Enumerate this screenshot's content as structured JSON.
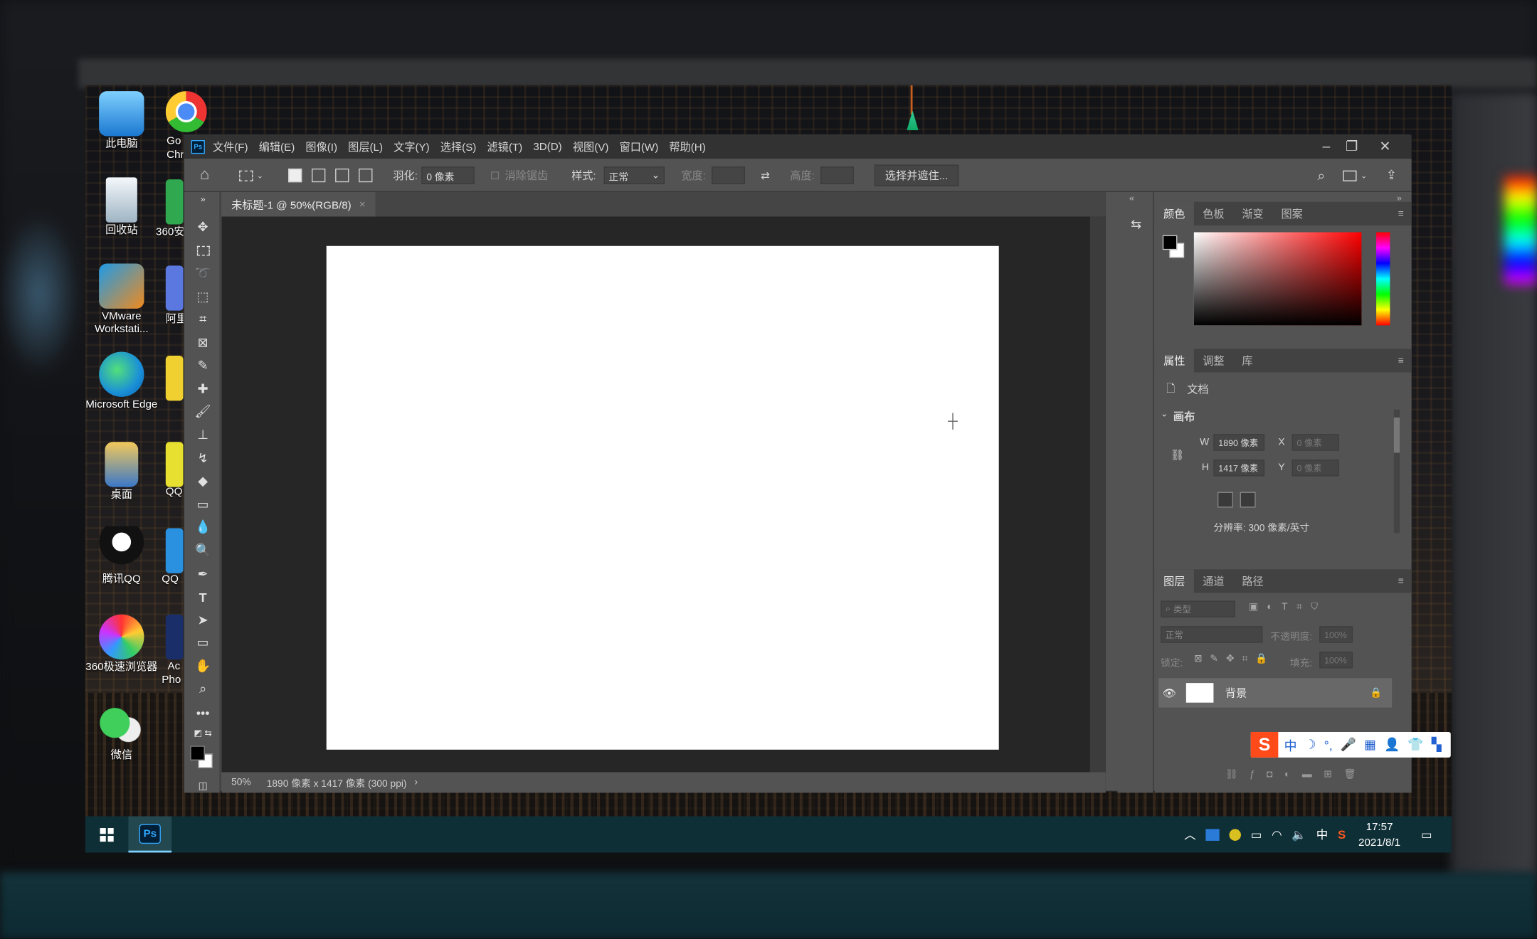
{
  "desktop": {
    "icons": [
      {
        "label": "此电脑"
      },
      {
        "label": "回收站"
      },
      {
        "label": "VMware Workstati..."
      },
      {
        "label": "Microsoft Edge"
      },
      {
        "label": "桌面"
      },
      {
        "label": "腾讯QQ"
      },
      {
        "label": "360极速浏览器"
      },
      {
        "label": "微信"
      }
    ],
    "partial_labels": [
      "Go",
      "Chr",
      "360安",
      "阿里",
      "QQ",
      "QQ",
      "Ac",
      "Pho"
    ]
  },
  "ps": {
    "menu": [
      "文件(F)",
      "编辑(E)",
      "图像(I)",
      "图层(L)",
      "文字(Y)",
      "选择(S)",
      "滤镜(T)",
      "3D(D)",
      "视图(V)",
      "窗口(W)",
      "帮助(H)"
    ],
    "options": {
      "feather_label": "羽化:",
      "feather_value": "0 像素",
      "antialias": "消除锯齿",
      "style_label": "样式:",
      "style_value": "正常",
      "width_label": "宽度:",
      "height_label": "高度:",
      "select_mask": "选择并遮住..."
    },
    "doc_tab": "未标题-1 @ 50%(RGB/8)",
    "status": {
      "zoom": "50%",
      "info": "1890 像素 x 1417 像素 (300 ppi)"
    },
    "color_panel": {
      "tabs": [
        "颜色",
        "色板",
        "渐变",
        "图案"
      ]
    },
    "properties_panel": {
      "tabs": [
        "属性",
        "调整",
        "库"
      ],
      "doc_label": "文档",
      "section": "画布",
      "w_label": "W",
      "w_value": "1890 像素",
      "h_label": "H",
      "h_value": "1417 像素",
      "x_label": "X",
      "x_value": "0 像素",
      "y_label": "Y",
      "y_value": "0 像素",
      "resolution": "分辨率: 300 像素/英寸"
    },
    "layers_panel": {
      "tabs": [
        "图层",
        "通道",
        "路径"
      ],
      "filter": "类型",
      "blend": "正常",
      "opacity_label": "不透明度:",
      "opacity_value": "100%",
      "lock_label": "锁定:",
      "fill_label": "填充:",
      "fill_value": "100%",
      "layer_name": "背景"
    }
  },
  "taskbar": {
    "ps_label": "Ps",
    "time": "17:57",
    "date": "2021/8/1",
    "ime": "中"
  },
  "ime_bar": {
    "chars": [
      "中",
      "☽",
      "°,",
      "🎤",
      "▦",
      "👤",
      "👕",
      "▚"
    ]
  }
}
